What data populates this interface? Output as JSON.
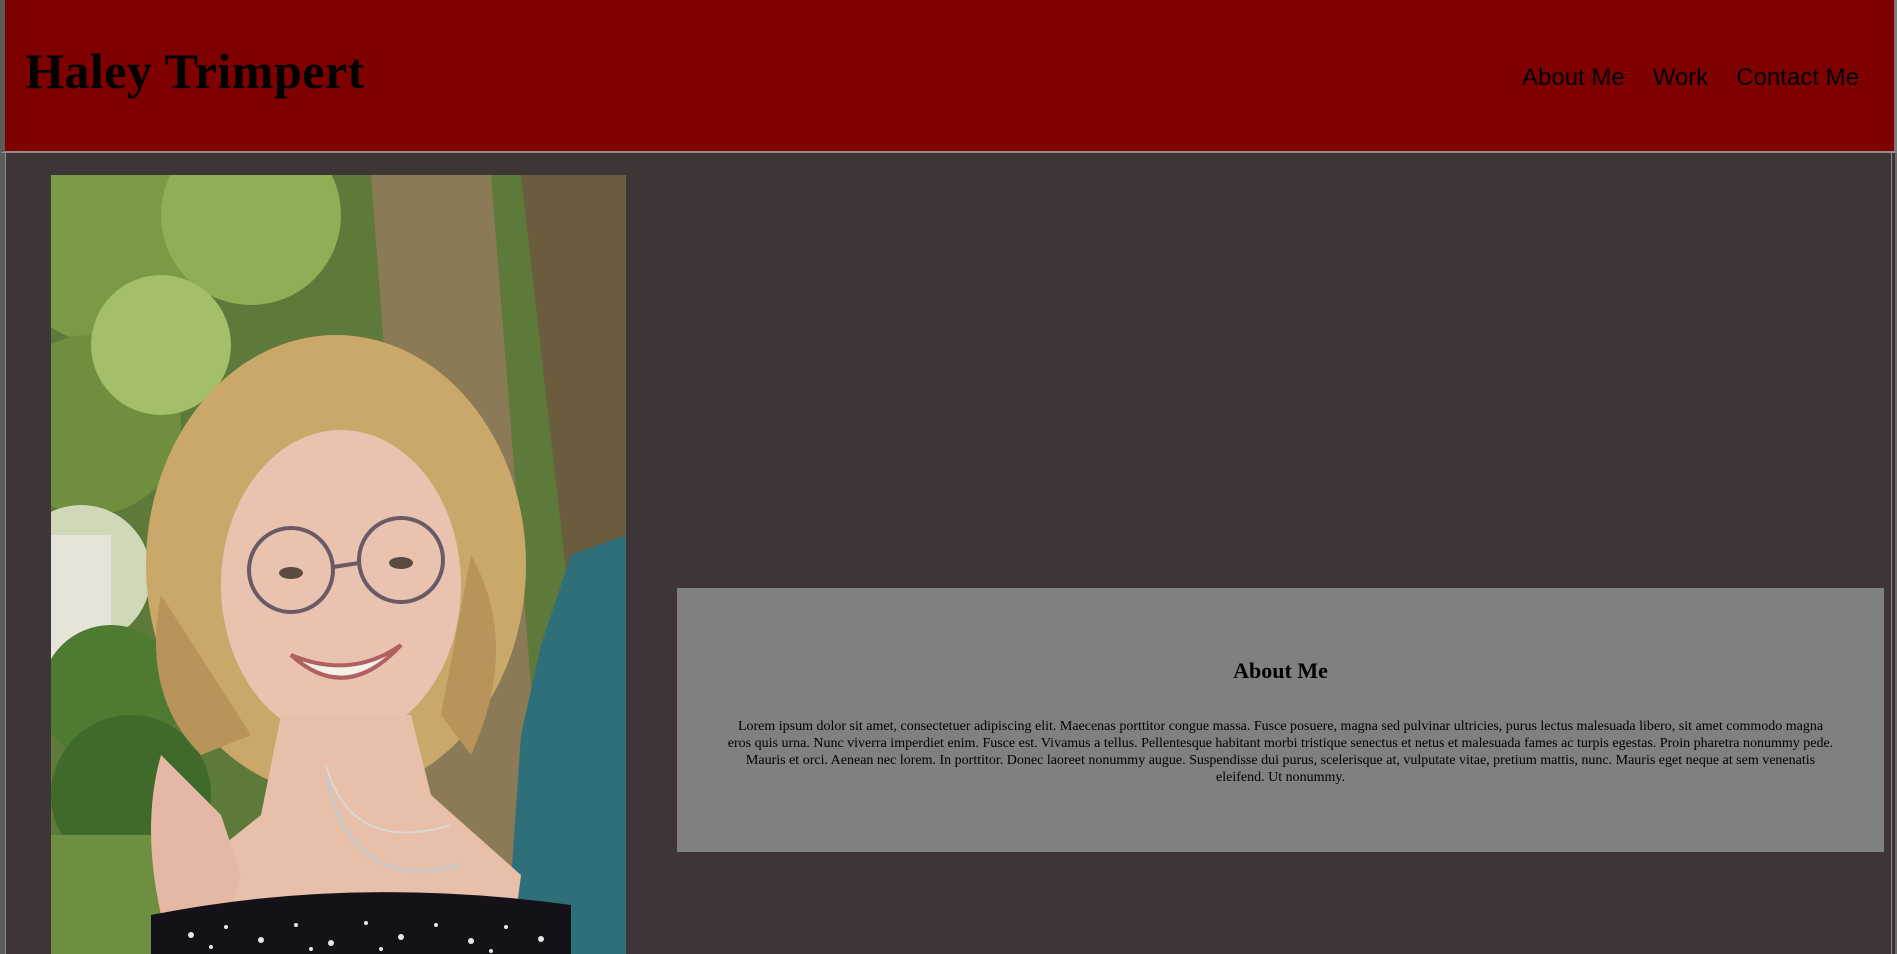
{
  "header": {
    "title": "Haley Trimpert",
    "background_color": "#7e0000"
  },
  "nav": {
    "items": [
      {
        "label": "About Me"
      },
      {
        "label": "Work"
      },
      {
        "label": "Contact Me"
      }
    ]
  },
  "main": {
    "background_color": "#3e3537",
    "photo_icon": "portrait-photo",
    "about": {
      "title": "About Me",
      "text": "Lorem ipsum dolor sit amet, consectetuer adipiscing elit. Maecenas porttitor congue massa. Fusce posuere, magna sed pulvinar ultricies, purus lectus malesuada libero, sit amet commodo magna eros quis urna. Nunc viverra imperdiet enim. Fusce est. Vivamus a tellus. Pellentesque habitant morbi tristique senectus et netus et malesuada fames ac turpis egestas. Proin pharetra nonummy pede. Mauris et orci. Aenean nec lorem. In porttitor. Donec laoreet nonummy augue. Suspendisse dui purus, scelerisque at, vulputate vitae, pretium mattis, nunc. Mauris eget neque at sem venenatis eleifend. Ut nonummy.",
      "background_color": "#808080"
    }
  }
}
